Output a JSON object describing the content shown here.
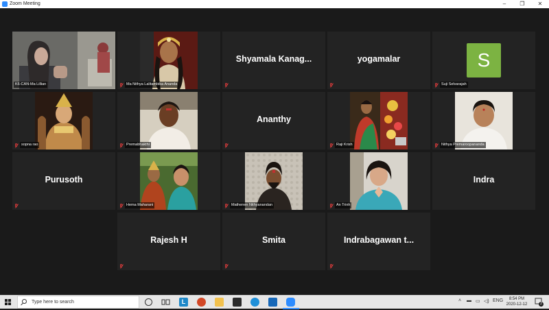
{
  "window": {
    "title": "Zoom Meeting"
  },
  "participants": [
    {
      "name": "K6-CAN-Ma Lillian",
      "video": true,
      "muted": false
    },
    {
      "name": "Ma Nithya Lalitambika Ananda",
      "video": true,
      "muted": true
    },
    {
      "name": "Shyamala Kanag...",
      "video": false,
      "muted": true
    },
    {
      "name": "yogamalar",
      "video": false,
      "muted": true
    },
    {
      "name": "Suji Selvarajah",
      "video": false,
      "avatar_letter": "S",
      "avatar_color": "#7cb342",
      "muted": true
    },
    {
      "name": "sopna rao",
      "video": true,
      "muted": true
    },
    {
      "name": "Premabhakthi",
      "video": true,
      "muted": true
    },
    {
      "name": "Ananthy",
      "video": false,
      "muted": true
    },
    {
      "name": "Raji Krish",
      "video": true,
      "muted": true
    },
    {
      "name": "Nithya Premaroopananda",
      "video": true,
      "muted": true
    },
    {
      "name": "Purusoth",
      "video": false,
      "muted": true
    },
    {
      "name": "Hema Maharani",
      "video": true,
      "muted": true
    },
    {
      "name": "Mathenen Nithyanandan",
      "video": true,
      "muted": true
    },
    {
      "name": "An Trinh",
      "video": true,
      "muted": true
    },
    {
      "name": "Indra",
      "video": false,
      "muted": true
    },
    {
      "name": "Rajesh H",
      "video": false,
      "muted": true
    },
    {
      "name": "Smita",
      "video": false,
      "muted": true
    },
    {
      "name": "Indrabagawan t...",
      "video": false,
      "muted": true
    }
  ],
  "taskbar": {
    "search_placeholder": "Type here to search",
    "language": "ENG",
    "time": "8:54 PM",
    "date": "2020-12-12",
    "notification_count": "2"
  },
  "colors": {
    "active_speaker_border": "#ccd64a",
    "mute_icon": "#e03c3c",
    "tile_bg": "#232323"
  }
}
